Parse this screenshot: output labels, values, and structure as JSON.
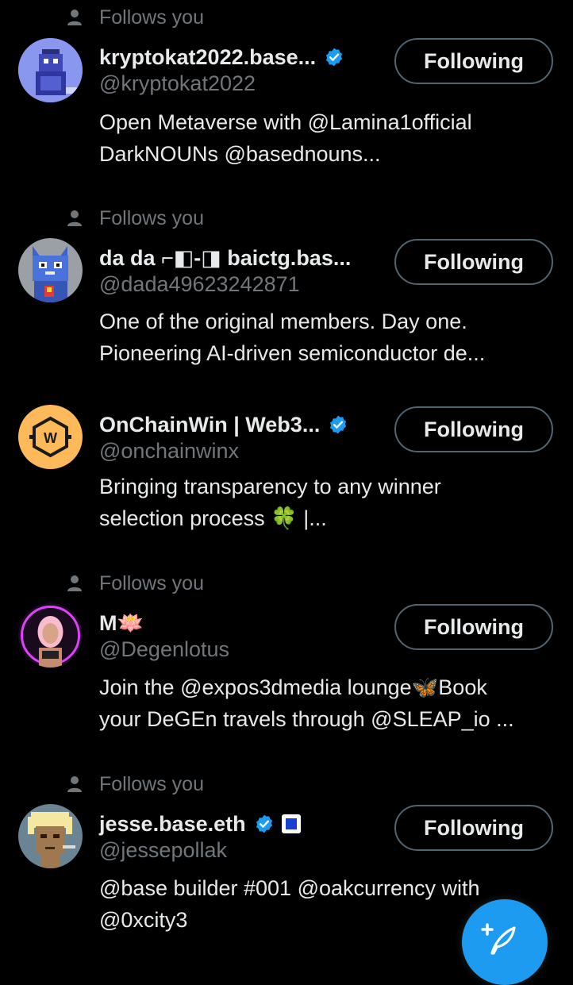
{
  "follows_you_label": "Follows you",
  "colors": {
    "background": "#000000",
    "primary_text": "#e7e9ea",
    "secondary_text": "#71767b",
    "verified_blue": "#1d9bf0",
    "button_border": "#536471",
    "fab": "#1d9bf0"
  },
  "users": [
    {
      "follows_you": true,
      "name": "kryptokat2022.base...",
      "verified": true,
      "handle": "@kryptokat2022",
      "bio_line1": "Open Metaverse with @Lamina1official",
      "bio_line2": "DarkNOUNs @basednouns...",
      "button_label": "Following",
      "avatar_icon": "pixel-cat-avatar"
    },
    {
      "follows_you": true,
      "name": "da da ⌐◧-◨ baictg.bas...",
      "verified": false,
      "handle": "@dada49623242871",
      "bio_line1": "One of the original members. Day one.",
      "bio_line2": "Pioneering AI-driven semiconductor de...",
      "button_label": "Following",
      "avatar_icon": "pixel-blue-cat-avatar"
    },
    {
      "follows_you": false,
      "name": "OnChainWin | Web3...",
      "verified": true,
      "handle": "@onchainwinx",
      "bio_line1": "Bringing transparency to any winner",
      "bio_line2": "selection process 🍀 |...",
      "button_label": "Following",
      "avatar_icon": "w-hexagon-logo-avatar"
    },
    {
      "follows_you": true,
      "name": "M🪷",
      "verified": false,
      "handle": "@Degenlotus",
      "bio_line1": "Join the @expos3dmedia lounge🦋Book",
      "bio_line2": "your DeGEn travels through @SLEAP_io ...",
      "button_label": "Following",
      "avatar_icon": "pink-portrait-avatar"
    },
    {
      "follows_you": true,
      "name": "jesse.base.eth",
      "verified": true,
      "handle": "@jessepollak",
      "bio_line1": "@base builder #001 @oakcurrency with",
      "bio_line2": "@0xcity3",
      "button_label": "Following",
      "avatar_icon": "cryptopunk-avatar"
    }
  ],
  "fab_icon": "compose-post-icon"
}
